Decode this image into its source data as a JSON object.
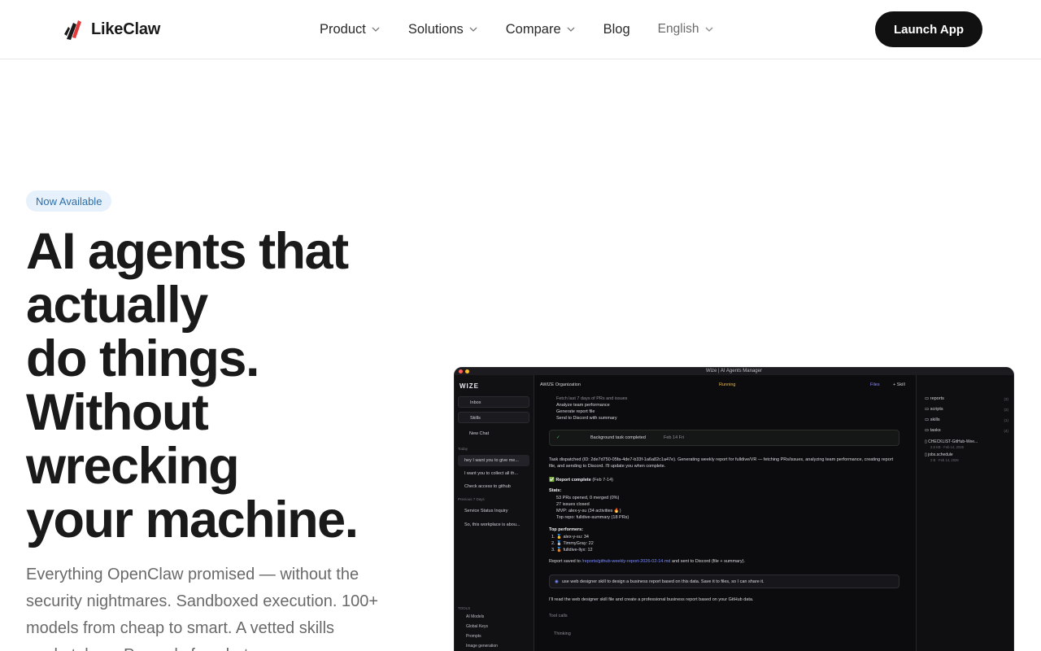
{
  "header": {
    "brand": "LikeClaw",
    "nav": [
      {
        "label": "Product",
        "dropdown": true
      },
      {
        "label": "Solutions",
        "dropdown": true
      },
      {
        "label": "Compare",
        "dropdown": true
      },
      {
        "label": "Blog",
        "dropdown": false
      }
    ],
    "language": "English",
    "cta": "Launch App",
    "colors": {
      "cta_bg": "#111111",
      "logo_red": "#e23b3b"
    }
  },
  "hero": {
    "badge": "Now Available",
    "title_lines": [
      "AI agents that",
      "actually",
      "do things.",
      "Without",
      "wrecking",
      "your machine."
    ],
    "subtitle": "Everything OpenClaw promised — without the security nightmares. Sandboxed execution. 100+ models from cheap to smart. A vetted skills marketplace. Pay only for what you use.",
    "colors": {
      "badge_bg": "#e6f1fb",
      "badge_text": "#2f6ea8"
    }
  },
  "screenshot": {
    "window_title": "Wize | AI Agents Manager",
    "sidebar": {
      "logo": "WIZE",
      "inbox": "Inbox",
      "skills": "Skills",
      "new_chat": "New Chat",
      "today_label": "Today",
      "today": [
        "hey I want you to give me...",
        "I want you to collect all th...",
        "Check access to github"
      ],
      "prev_label": "Previous 7 Days",
      "previous": [
        "Service Status Inquiry",
        "So, this workplace is abou..."
      ],
      "tools_label": "TOOLS",
      "tools": [
        "AI Models",
        "Global Keys",
        "Prompts",
        "Image generation"
      ]
    },
    "main": {
      "org": "AWIZE Organization",
      "status": "Running",
      "files_tab": "Files",
      "skill_tab": "+ Skill",
      "steps": [
        "Fetch last 7 days of PRs and issues",
        "Analyze team performance",
        "Generate report file",
        "Send to Discord with summary"
      ],
      "bg_task": "Background task completed",
      "bg_task_sub": "Feb 14 Fri",
      "dispatch_1": "Task dispatched (ID: 2de7d750-05fa-4de7-b33f-1a6a82c1a47e). Generating weekly report for fulldive/VR — fetching PRs/issues, analyzing team performance, creating report",
      "dispatch_2": "file, and sending to Discord. I'll update you when complete.",
      "report_title": "Report complete",
      "report_range": "(Feb 7-14)",
      "stats_label": "Stats:",
      "stats": [
        "53 PRs opened, 0 merged (0%)",
        "27 issues closed",
        "MVP: alex-y-su (34 activities 🔥)",
        "Top repo: fulldive-summary (18 PRs)"
      ],
      "top_label": "Top performers:",
      "top": [
        "1. 🥇 alex-y-su: 34",
        "2. 🥈 TimmyGray: 22",
        "3. 🥉 fulldive-llyx: 12"
      ],
      "saved_prefix": "Report saved to",
      "saved_path": "/reports/github-weekly-report-2026-02-14.md",
      "saved_suffix": "and sent to Discord (file + summary).",
      "prompt": "use web designer skill to design a business report based on this data. Save it to files, so I can share it.",
      "reply": "I'll read the web designer skill file and create a professional business report based on your GitHub data.",
      "tool_calls": "Tool calls",
      "thinking": "Thinking"
    },
    "files": {
      "folders": [
        {
          "name": "reports",
          "count": "(3)"
        },
        {
          "name": "scripts",
          "count": "(3)"
        },
        {
          "name": "skills",
          "count": "(1)"
        },
        {
          "name": "tasks",
          "count": "(4)"
        }
      ],
      "docs": [
        {
          "name": "CHECKLIST-GitHub-Wee...",
          "meta": "2.8 KB · Feb 14, 2026"
        },
        {
          "name": "jobs.schedule",
          "meta": "2 B · Feb 14, 2026"
        }
      ]
    }
  }
}
